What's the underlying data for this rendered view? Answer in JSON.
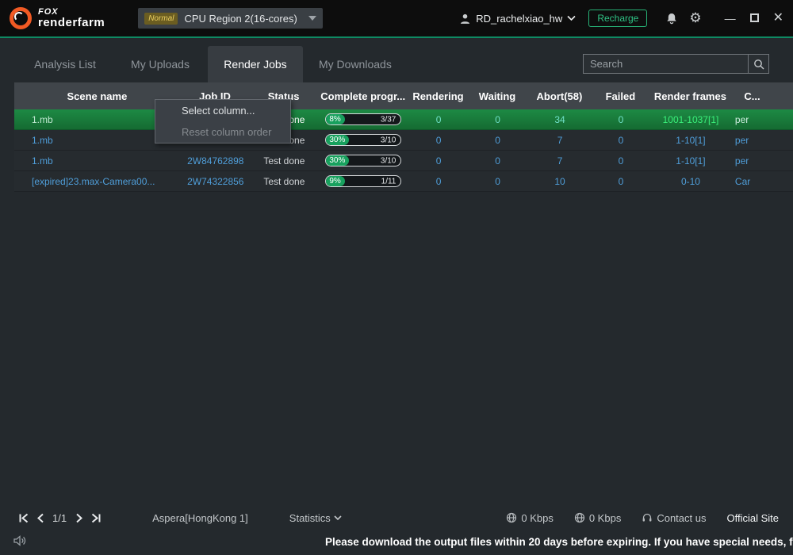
{
  "titlebar": {
    "brand_top": "FOX",
    "brand_bottom": "renderfarm",
    "region_badge": "Normal",
    "region_label": "CPU Region 2(16-cores)",
    "username": "RD_rachelxiao_hw",
    "recharge_label": "Recharge",
    "minimize_glyph": "—",
    "close_glyph": "✕"
  },
  "tabs": [
    {
      "label": "Analysis List"
    },
    {
      "label": "My Uploads"
    },
    {
      "label": "Render Jobs"
    },
    {
      "label": "My Downloads"
    }
  ],
  "search": {
    "placeholder": "Search"
  },
  "table": {
    "columns": [
      "Scene name",
      "Job ID",
      "Status",
      "Complete progr...",
      "Rendering",
      "Waiting",
      "Abort(58)",
      "Failed",
      "Render frames",
      "C..."
    ],
    "rows": [
      {
        "scene": "1.mb",
        "job_id": "",
        "status": "Test done",
        "progress_pct": "8%",
        "progress_value": 8,
        "progress_frac": "3/37",
        "rendering": "0",
        "waiting": "0",
        "abort": "34",
        "failed": "0",
        "frames": "1001-1037[1]",
        "extra": "per"
      },
      {
        "scene": "1.mb",
        "job_id": "",
        "status": "Test done",
        "progress_pct": "30%",
        "progress_value": 30,
        "progress_frac": "3/10",
        "rendering": "0",
        "waiting": "0",
        "abort": "7",
        "failed": "0",
        "frames": "1-10[1]",
        "extra": "per"
      },
      {
        "scene": "1.mb",
        "job_id": "2W84762898",
        "status": "Test done",
        "progress_pct": "30%",
        "progress_value": 30,
        "progress_frac": "3/10",
        "rendering": "0",
        "waiting": "0",
        "abort": "7",
        "failed": "0",
        "frames": "1-10[1]",
        "extra": "per"
      },
      {
        "scene": "[expired]23.max-Camera00...",
        "job_id": "2W74322856",
        "status": "Test done",
        "progress_pct": "9%",
        "progress_value": 9,
        "progress_frac": "1/11",
        "rendering": "0",
        "waiting": "0",
        "abort": "10",
        "failed": "0",
        "frames": "0-10",
        "extra": "Car"
      }
    ]
  },
  "context_menu": {
    "select_column": "Select column...",
    "reset_order": "Reset column order"
  },
  "footer": {
    "page": "1/1",
    "aspera": "Aspera[HongKong 1]",
    "statistics": "Statistics",
    "upload_speed": "0 Kbps",
    "download_speed": "0 Kbps",
    "contact": "Contact us",
    "official_site": "Official Site",
    "notice": "Please download the output files within 20 days before expiring. If you have special needs, feel fre"
  }
}
